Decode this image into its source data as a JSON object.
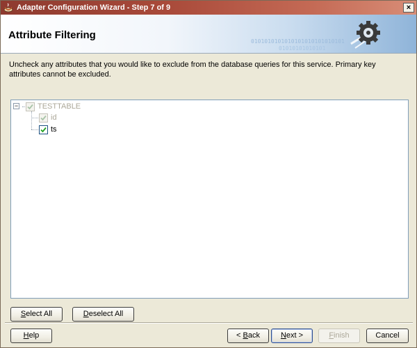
{
  "window": {
    "title": "Adapter Configuration Wizard - Step 7 of 9",
    "close_label": "×"
  },
  "header": {
    "title": "Attribute Filtering",
    "binary_line1": "0101010101010101010101010101",
    "binary_line2": "01010101010101"
  },
  "instructions": "Uncheck any attributes that you would like to exclude from the database queries for this service.  Primary key attributes cannot be excluded.",
  "tree": {
    "root": {
      "label": "TESTTABLE",
      "checked": true,
      "disabled": true,
      "expanded": true
    },
    "children": [
      {
        "label": "id",
        "checked": true,
        "disabled": true
      },
      {
        "label": "ts",
        "checked": true,
        "disabled": false
      }
    ]
  },
  "buttons": {
    "select_all": {
      "mnemonic": "S",
      "rest": "elect All"
    },
    "deselect_all": {
      "mnemonic": "D",
      "rest": "eselect All"
    },
    "help": {
      "mnemonic": "H",
      "rest": "elp"
    },
    "back": {
      "prefix": "< ",
      "mnemonic": "B",
      "rest": "ack"
    },
    "next": {
      "mnemonic": "N",
      "rest": "ext >"
    },
    "finish": {
      "mnemonic": "F",
      "rest": "inish"
    },
    "cancel": {
      "label": "Cancel"
    }
  },
  "colors": {
    "titlebar": "#a94a3a",
    "check": "#21a121",
    "check_disabled": "#a8c4a8"
  }
}
